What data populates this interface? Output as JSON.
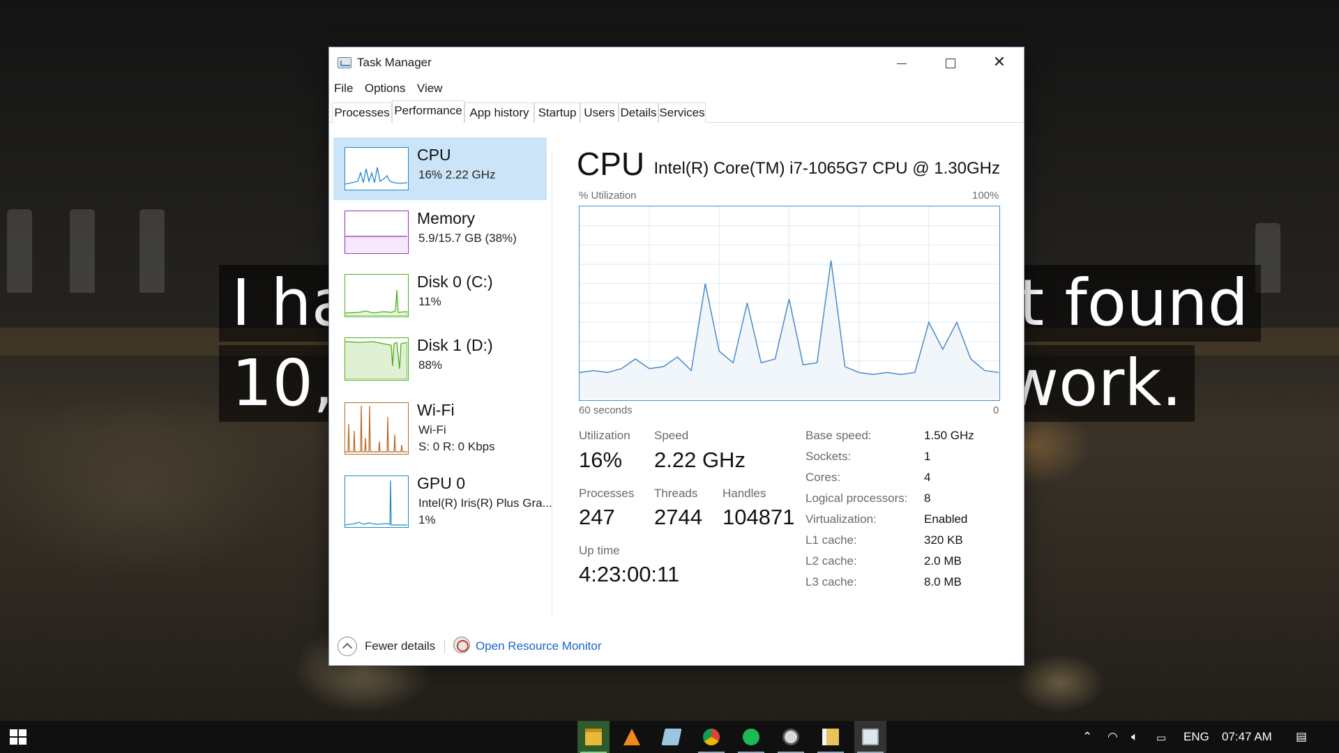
{
  "wallpaper": {
    "line1": "I have not failed. I've just found",
    "line2": "10,000 ways that won't work."
  },
  "window": {
    "title": "Task Manager",
    "menu": [
      "File",
      "Options",
      "View"
    ],
    "tabs": [
      "Processes",
      "Performance",
      "App history",
      "Startup",
      "Users",
      "Details",
      "Services"
    ],
    "active_tab": "Performance"
  },
  "sidebar": {
    "items": [
      {
        "name": "CPU",
        "sub1": "16%  2.22 GHz",
        "color": "#1e88c8",
        "selected": true
      },
      {
        "name": "Memory",
        "sub1": "5.9/15.7 GB (38%)",
        "color": "#8b2fc0",
        "selected": false
      },
      {
        "name": "Disk 0 (C:)",
        "sub1": "11%",
        "color": "#4caf1a",
        "selected": false
      },
      {
        "name": "Disk 1 (D:)",
        "sub1": "88%",
        "color": "#4caf1a",
        "selected": false
      },
      {
        "name": "Wi-Fi",
        "sub1": "Wi-Fi",
        "sub2": "S: 0  R: 0 Kbps",
        "color": "#b8651e",
        "selected": false
      },
      {
        "name": "GPU 0",
        "sub1": "Intel(R) Iris(R) Plus Gra...",
        "sub2": "1%",
        "color": "#1e88c8",
        "selected": false
      }
    ]
  },
  "main": {
    "title": "CPU",
    "model": "Intel(R) Core(TM) i7-1065G7 CPU @ 1.30GHz",
    "y_label": "% Utilization",
    "y_max_label": "100%",
    "x_left_label": "60 seconds",
    "x_right_label": "0",
    "stats": {
      "utilization_label": "Utilization",
      "utilization": "16%",
      "speed_label": "Speed",
      "speed": "2.22 GHz",
      "processes_label": "Processes",
      "processes": "247",
      "threads_label": "Threads",
      "threads": "2744",
      "handles_label": "Handles",
      "handles": "104871",
      "uptime_label": "Up time",
      "uptime": "4:23:00:11"
    },
    "specs": [
      {
        "label": "Base speed:",
        "value": "1.50 GHz"
      },
      {
        "label": "Sockets:",
        "value": "1"
      },
      {
        "label": "Cores:",
        "value": "4"
      },
      {
        "label": "Logical processors:",
        "value": "8"
      },
      {
        "label": "Virtualization:",
        "value": "Enabled"
      },
      {
        "label": "L1 cache:",
        "value": "320 KB"
      },
      {
        "label": "L2 cache:",
        "value": "2.0 MB"
      },
      {
        "label": "L3 cache:",
        "value": "8.0 MB"
      }
    ]
  },
  "chart_data": {
    "type": "area",
    "ylim": [
      0,
      100
    ],
    "x": [
      60,
      58,
      56,
      54,
      52,
      50,
      48,
      46,
      44,
      42,
      40,
      38,
      36,
      34,
      32,
      30,
      28,
      26,
      24,
      22,
      20,
      18,
      16,
      14,
      12,
      10,
      8,
      6,
      4,
      2,
      0
    ],
    "values": [
      14,
      15,
      14,
      16,
      21,
      16,
      17,
      22,
      15,
      60,
      25,
      19,
      50,
      19,
      21,
      52,
      18,
      19,
      72,
      17,
      14,
      13,
      14,
      13,
      14,
      40,
      26,
      40,
      21,
      15,
      14
    ]
  },
  "footer": {
    "fewer_details": "Fewer details",
    "open_resource_monitor": "Open Resource Monitor"
  },
  "taskbar": {
    "language": "ENG",
    "time": "07:47 AM"
  }
}
